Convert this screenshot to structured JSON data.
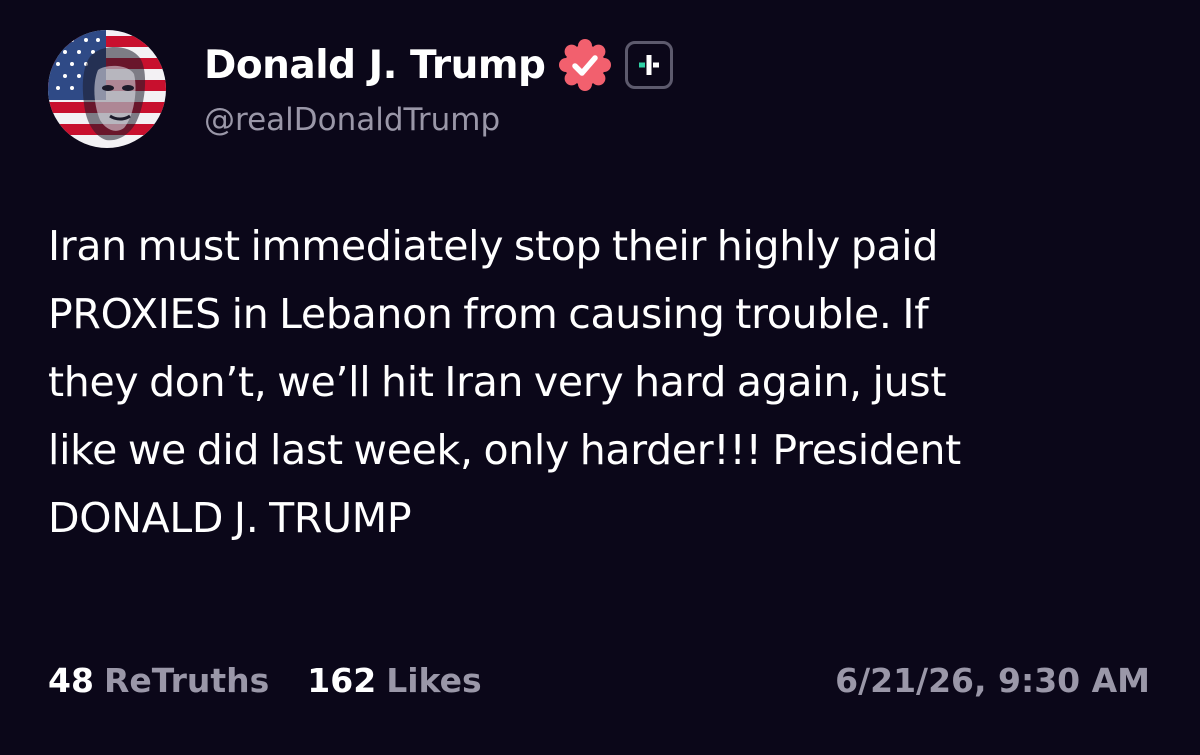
{
  "author": {
    "display_name": "Donald J. Trump",
    "handle": "@realDonaldTrump",
    "verified": true,
    "verified_badge_color": "#f2606e",
    "plus_badge_accent": "#2fd1a5"
  },
  "post": {
    "lines": [
      "Iran must immediately stop their highly paid",
      "PROXIES in Lebanon from causing trouble. If",
      "they don’t, we’ll hit Iran very hard again, just",
      "like we did last week, only harder!!! President",
      "DONALD J. TRUMP"
    ]
  },
  "stats": {
    "retruths_count": "48",
    "retruths_label": "ReTruths",
    "likes_count": "162",
    "likes_label": "Likes"
  },
  "timestamp": "6/21/26, 9:30 AM",
  "colors": {
    "background": "#0b0719",
    "text_primary": "#ffffff",
    "text_secondary": "#9a97a8"
  }
}
